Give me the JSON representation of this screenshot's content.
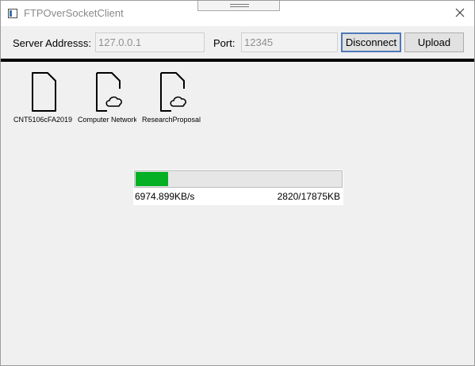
{
  "window": {
    "title": "FTPOverSocketClient"
  },
  "toolbar": {
    "server_label": "Server Addresss:",
    "server_value": "127.0.0.1",
    "port_label": "Port:",
    "port_value": "12345",
    "disconnect_label": "Disconnect",
    "upload_label": "Upload"
  },
  "files": [
    {
      "name": "CNT5106cFA2019",
      "icon": "file-icon"
    },
    {
      "name": "Computer Networks",
      "icon": "cloud-file-icon"
    },
    {
      "name": "ResearchProposal",
      "icon": "cloud-file-icon"
    }
  ],
  "transfer": {
    "speed": "6974.899KB/s",
    "progress_text": "2820/17875KB",
    "transferred_kb": 2820,
    "total_kb": 17875,
    "fill_color": "#06b025"
  }
}
